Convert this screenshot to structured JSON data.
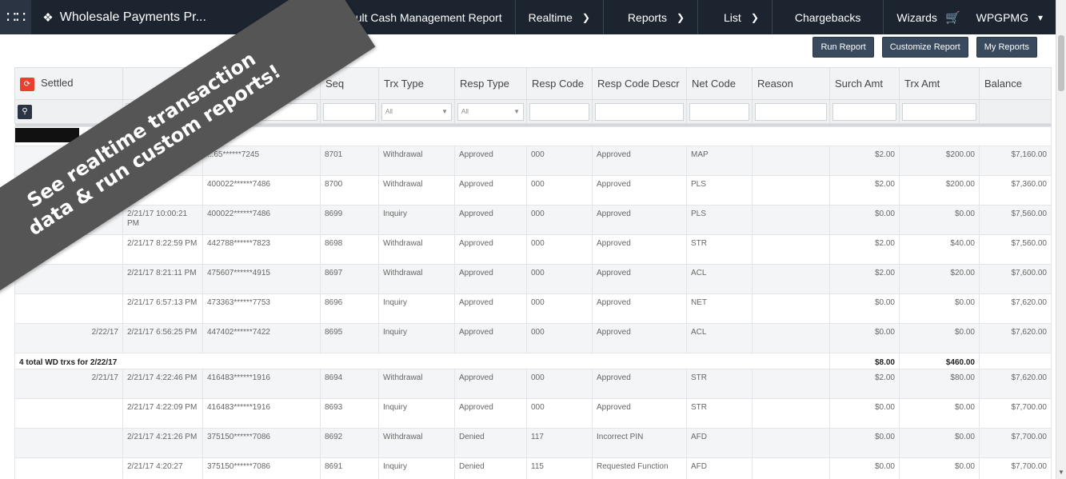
{
  "topbar": {
    "brand": "Wholesale Payments Pr...",
    "report_name": "Default Cash Management Report",
    "nav": [
      {
        "label": "Realtime",
        "has_dropdown": true
      },
      {
        "label": "Reports",
        "has_dropdown": true
      },
      {
        "label": "List",
        "has_dropdown": true
      },
      {
        "label": "Chargebacks",
        "has_dropdown": false
      },
      {
        "label": "Wizards",
        "has_dropdown": false
      },
      {
        "label": "WPGPMG",
        "has_dropdown": true
      }
    ],
    "colors": {
      "bar": "#1c2430",
      "accent_red": "#e8402f"
    }
  },
  "toolbar": {
    "run_report": "Run Report",
    "customize_report": "Customize Report",
    "my_reports": "My Reports"
  },
  "table": {
    "headers": [
      "Settled",
      "",
      "",
      "Seq",
      "Trx Type",
      "Resp Type",
      "Resp Code",
      "Resp Code Descr",
      "Net Code",
      "Reason",
      "Surch Amt",
      "Trx Amt",
      "Balance"
    ],
    "filters": {
      "trx_type": "All",
      "resp_type": "All"
    },
    "rows": [
      {
        "settled": "",
        "time": "",
        "card": "...65******7245",
        "seq": "8701",
        "trx_type": "Withdrawal",
        "resp_type": "Approved",
        "resp_code": "000",
        "descr": "Approved",
        "net": "MAP",
        "reason": "",
        "surch": "$2.00",
        "trx_amt": "$200.00",
        "balance": "$7,160.00"
      },
      {
        "settled": "",
        "time": "...01:09",
        "card": "400022******7486",
        "seq": "8700",
        "trx_type": "Withdrawal",
        "resp_type": "Approved",
        "resp_code": "000",
        "descr": "Approved",
        "net": "PLS",
        "reason": "",
        "surch": "$2.00",
        "trx_amt": "$200.00",
        "balance": "$7,360.00"
      },
      {
        "settled": "",
        "time": "2/21/17 10:00:21 PM",
        "card": "400022******7486",
        "seq": "8699",
        "trx_type": "Inquiry",
        "resp_type": "Approved",
        "resp_code": "000",
        "descr": "Approved",
        "net": "PLS",
        "reason": "",
        "surch": "$0.00",
        "trx_amt": "$0.00",
        "balance": "$7,560.00"
      },
      {
        "settled": "",
        "time": "2/21/17 8:22:59 PM",
        "card": "442788******7823",
        "seq": "8698",
        "trx_type": "Withdrawal",
        "resp_type": "Approved",
        "resp_code": "000",
        "descr": "Approved",
        "net": "STR",
        "reason": "",
        "surch": "$2.00",
        "trx_amt": "$40.00",
        "balance": "$7,560.00"
      },
      {
        "settled": "",
        "time": "2/21/17 8:21:11 PM",
        "card": "475607******4915",
        "seq": "8697",
        "trx_type": "Withdrawal",
        "resp_type": "Approved",
        "resp_code": "000",
        "descr": "Approved",
        "net": "ACL",
        "reason": "",
        "surch": "$2.00",
        "trx_amt": "$20.00",
        "balance": "$7,600.00"
      },
      {
        "settled": "",
        "time": "2/21/17 6:57:13 PM",
        "card": "473363******7753",
        "seq": "8696",
        "trx_type": "Inquiry",
        "resp_type": "Approved",
        "resp_code": "000",
        "descr": "Approved",
        "net": "NET",
        "reason": "",
        "surch": "$0.00",
        "trx_amt": "$0.00",
        "balance": "$7,620.00"
      },
      {
        "settled": "2/22/17",
        "time": "2/21/17 6:56:25 PM",
        "card": "447402******7422",
        "seq": "8695",
        "trx_type": "Inquiry",
        "resp_type": "Approved",
        "resp_code": "000",
        "descr": "Approved",
        "net": "ACL",
        "reason": "",
        "surch": "$0.00",
        "trx_amt": "$0.00",
        "balance": "$7,620.00"
      }
    ],
    "total": {
      "label": "4 total WD trxs for 2/22/17",
      "surch": "$8.00",
      "trx_amt": "$460.00"
    },
    "rows2": [
      {
        "settled": "2/21/17",
        "time": "2/21/17 4:22:46 PM",
        "card": "416483******1916",
        "seq": "8694",
        "trx_type": "Withdrawal",
        "resp_type": "Approved",
        "resp_code": "000",
        "descr": "Approved",
        "net": "STR",
        "reason": "",
        "surch": "$2.00",
        "trx_amt": "$80.00",
        "balance": "$7,620.00"
      },
      {
        "settled": "",
        "time": "2/21/17 4:22:09 PM",
        "card": "416483******1916",
        "seq": "8693",
        "trx_type": "Inquiry",
        "resp_type": "Approved",
        "resp_code": "000",
        "descr": "Approved",
        "net": "STR",
        "reason": "",
        "surch": "$0.00",
        "trx_amt": "$0.00",
        "balance": "$7,700.00"
      },
      {
        "settled": "",
        "time": "2/21/17 4:21:26 PM",
        "card": "375150******7086",
        "seq": "8692",
        "trx_type": "Withdrawal",
        "resp_type": "Denied",
        "resp_code": "117",
        "descr": "Incorrect PIN",
        "net": "AFD",
        "reason": "",
        "surch": "$0.00",
        "trx_amt": "$0.00",
        "balance": "$7,700.00"
      },
      {
        "settled": "",
        "time": "2/21/17 4:20:27",
        "card": "375150******7086",
        "seq": "8691",
        "trx_type": "Inquiry",
        "resp_type": "Denied",
        "resp_code": "115",
        "descr": "Requested Function",
        "net": "AFD",
        "reason": "",
        "surch": "$0.00",
        "trx_amt": "$0.00",
        "balance": "$7,700.00"
      }
    ]
  },
  "banner": {
    "line1": "See realtime transaction",
    "line2": "data & run custom reports!"
  }
}
